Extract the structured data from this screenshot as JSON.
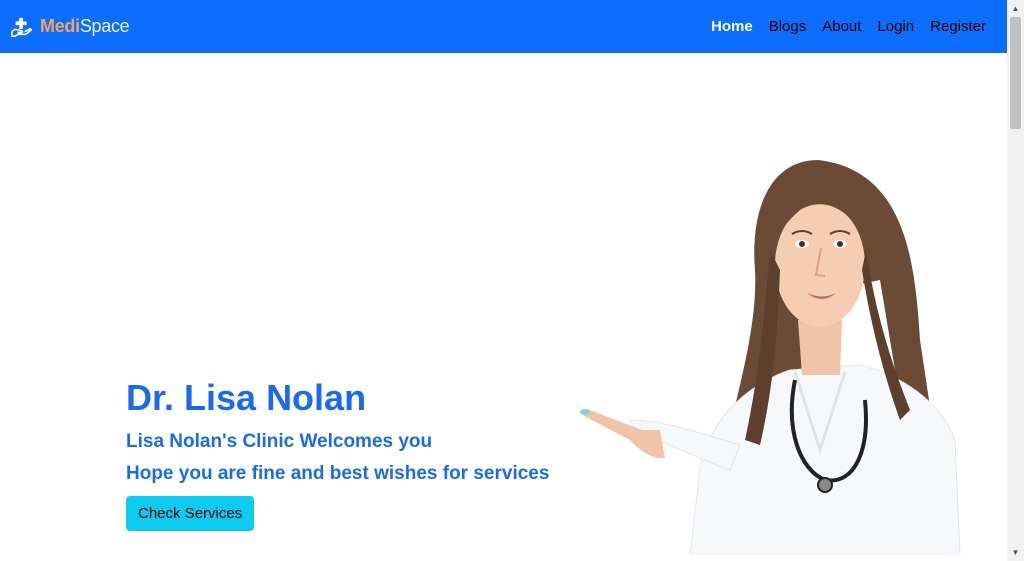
{
  "brand": {
    "part1": "Medi",
    "part2": "Space",
    "icon": "hand-plus-icon"
  },
  "nav": {
    "items": [
      {
        "label": "Home",
        "active": true
      },
      {
        "label": "Blogs"
      },
      {
        "label": "About"
      },
      {
        "label": "Login"
      },
      {
        "label": "Register"
      }
    ]
  },
  "hero": {
    "name": "Dr. Lisa Nolan",
    "line1": "Lisa Nolan's Clinic Welcomes you",
    "line2": "Hope you are fine and best wishes for services",
    "cta_label": "Check Services",
    "image": "doctor-pointing-illustration"
  },
  "colors": {
    "navbar": "#0d6efd",
    "accent_text": "#1a6ce6",
    "cta": "#0dcaf0",
    "brand_accent": "#f4a261"
  }
}
